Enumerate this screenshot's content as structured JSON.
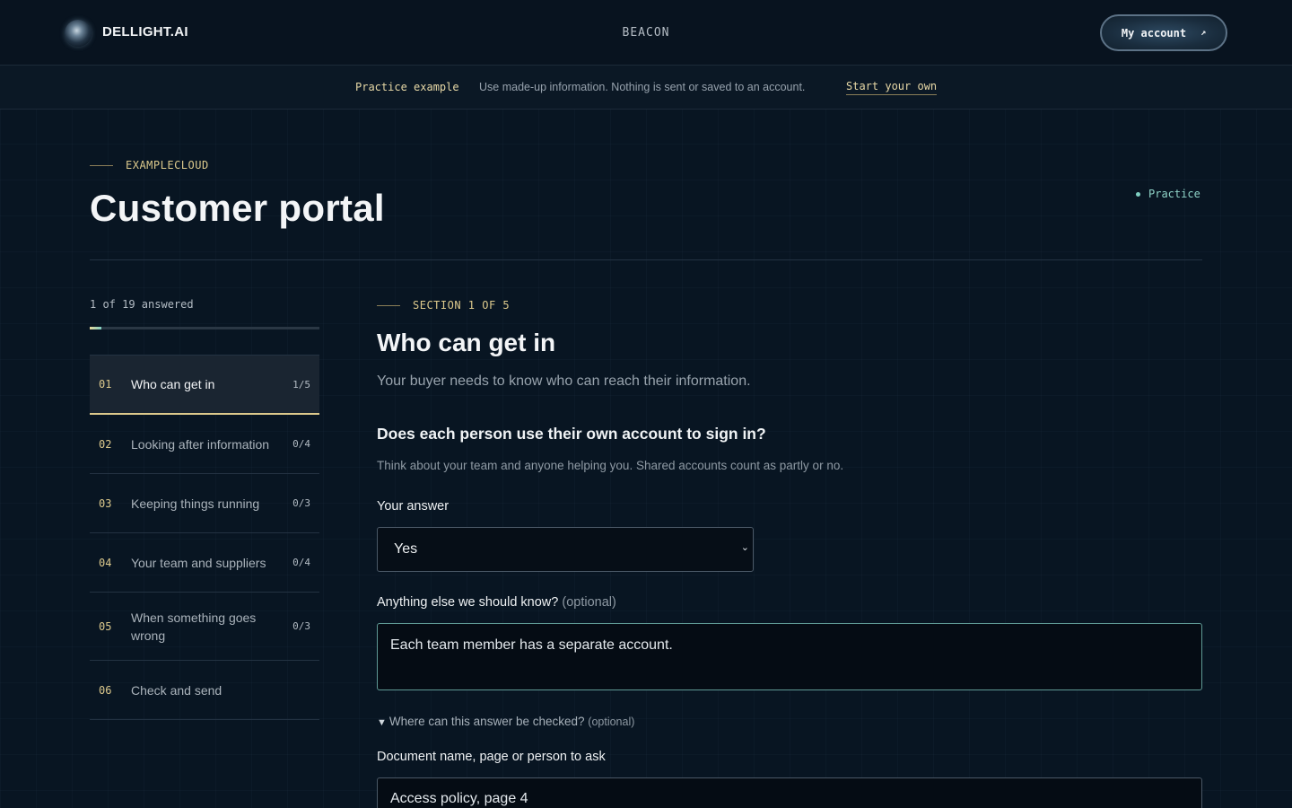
{
  "nav": {
    "brand": "DELLIGHT.AI",
    "center_link": "BEACON",
    "account_label": "My account",
    "account_arrow": "↗"
  },
  "practice_bar": {
    "label": "Practice example",
    "text": "Use made-up information. Nothing is sent or saved to an account.",
    "link": "Start your own"
  },
  "header": {
    "eyebrow": "EXAMPLECLOUD",
    "title": "Customer portal",
    "status": "Practice"
  },
  "sidebar": {
    "progress_text": "1 of 19 answered",
    "progress_fraction": 0.0526,
    "items": [
      {
        "num": "01",
        "label": "Who can get in",
        "count": "1/5"
      },
      {
        "num": "02",
        "label": "Looking after information",
        "count": "0/4"
      },
      {
        "num": "03",
        "label": "Keeping things running",
        "count": "0/3"
      },
      {
        "num": "04",
        "label": "Your team and suppliers",
        "count": "0/4"
      },
      {
        "num": "05",
        "label": "When something goes wrong",
        "count": "0/3"
      },
      {
        "num": "06",
        "label": "Check and send",
        "count": ""
      }
    ]
  },
  "main": {
    "section_eyebrow": "SECTION 1 OF 5",
    "section_title": "Who can get in",
    "section_desc": "Your buyer needs to know who can reach their information.",
    "question": "Does each person use their own account to sign in?",
    "hint": "Think about your team and anyone helping you. Shared accounts count as partly or no.",
    "answer_label": "Your answer",
    "answer_value": "Yes",
    "notes_label": "Anything else we should know?",
    "notes_optional": "(optional)",
    "notes_value": "Each team member has a separate account.",
    "details_label": "Where can this answer be checked?",
    "details_optional": "(optional)",
    "evidence_label": "Document name, page or person to ask",
    "evidence_value": "Access policy, page 4"
  },
  "colors": {
    "accent_gold": "#dcc98c",
    "accent_teal": "#7fcfc2",
    "background": "#081522"
  }
}
